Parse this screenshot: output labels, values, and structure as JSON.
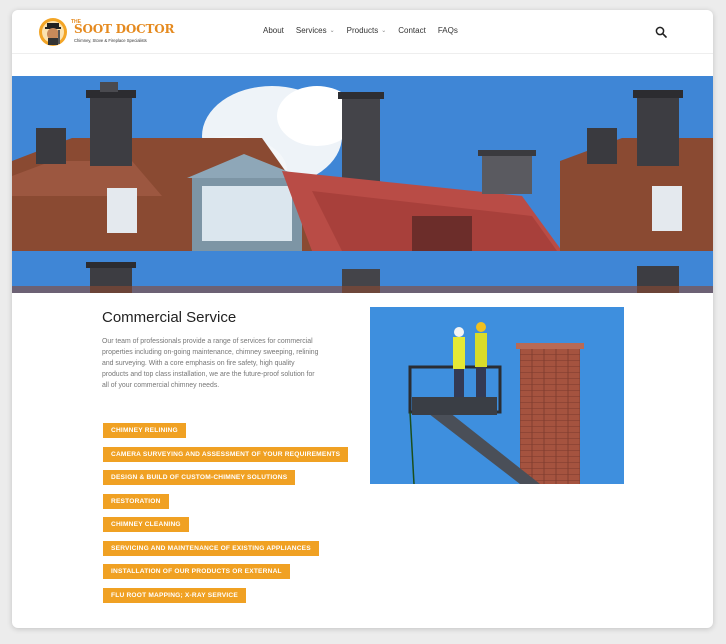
{
  "brand": {
    "the": "THE",
    "name": "SOOT DOCTOR",
    "tagline": "Chimney, Stove & Fireplace Specialists",
    "accent_color": "#f0a123"
  },
  "nav": {
    "items": [
      {
        "label": "About",
        "dropdown": false
      },
      {
        "label": "Services",
        "dropdown": true
      },
      {
        "label": "Products",
        "dropdown": true
      },
      {
        "label": "Contact",
        "dropdown": false
      },
      {
        "label": "FAQs",
        "dropdown": false
      }
    ],
    "chevron": "⌄",
    "search_icon": "search-icon"
  },
  "hero": {
    "image": "rooftops-chimneys-sky"
  },
  "content": {
    "title": "Commercial Service",
    "description": "Our team of professionals provide a range of services for commercial properties including on-going maintenance, chimney sweeping, relining and surveying. With a core emphasis on fire safety, high quality products and top class installation, we are the future-proof solution for all of your commercial chimney needs.",
    "services": [
      "CHIMNEY RELINING",
      "CAMERA SURVEYING AND ASSESSMENT OF YOUR REQUIREMENTS",
      "DESIGN & BUILD OF CUSTOM-CHIMNEY SOLUTIONS",
      "RESTORATION",
      "CHIMNEY CLEANING",
      "SERVICING AND MAINTENANCE OF EXISTING APPLIANCES",
      "INSTALLATION OF OUR PRODUCTS OR EXTERNAL",
      "FLU ROOT MAPPING; X-RAY SERVICE"
    ],
    "photo": "workers-on-lift-brick-chimney"
  }
}
